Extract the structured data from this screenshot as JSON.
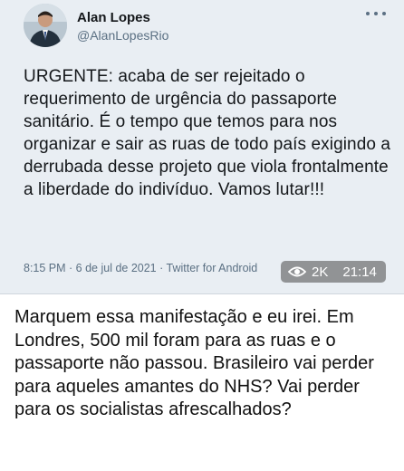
{
  "tweet": {
    "author_name": "Alan Lopes",
    "author_handle": "@AlanLopesRio",
    "text": "URGENTE: acaba de ser rejeitado o requerimento de urgência do passaporte sanitário. É o tempo que temos para nos organizar e sair as ruas de todo país exigindo a derrubada desse projeto que viola frontalmente a liberdade do indivíduo. Vamos lutar!!!",
    "timestamp": "8:15 PM · 6 de jul de 2021 · Twitter for Android",
    "more_icon": "more-horizontal-icon"
  },
  "video_overlay": {
    "icon": "eye-icon",
    "views": "2K",
    "duration": "21:14"
  },
  "caption": {
    "text": "Marquem essa manifestação e eu irei. Em Londres, 500 mil foram para as ruas e o passaporte não passou. Brasileiro vai perder para aqueles amantes do NHS? Vai perder para os socialistas afrescalhados?"
  },
  "colors": {
    "card_background": "#e9eef3",
    "text_primary": "#14171a",
    "text_secondary": "#5b7083",
    "overlay": "#5a5a5a"
  }
}
